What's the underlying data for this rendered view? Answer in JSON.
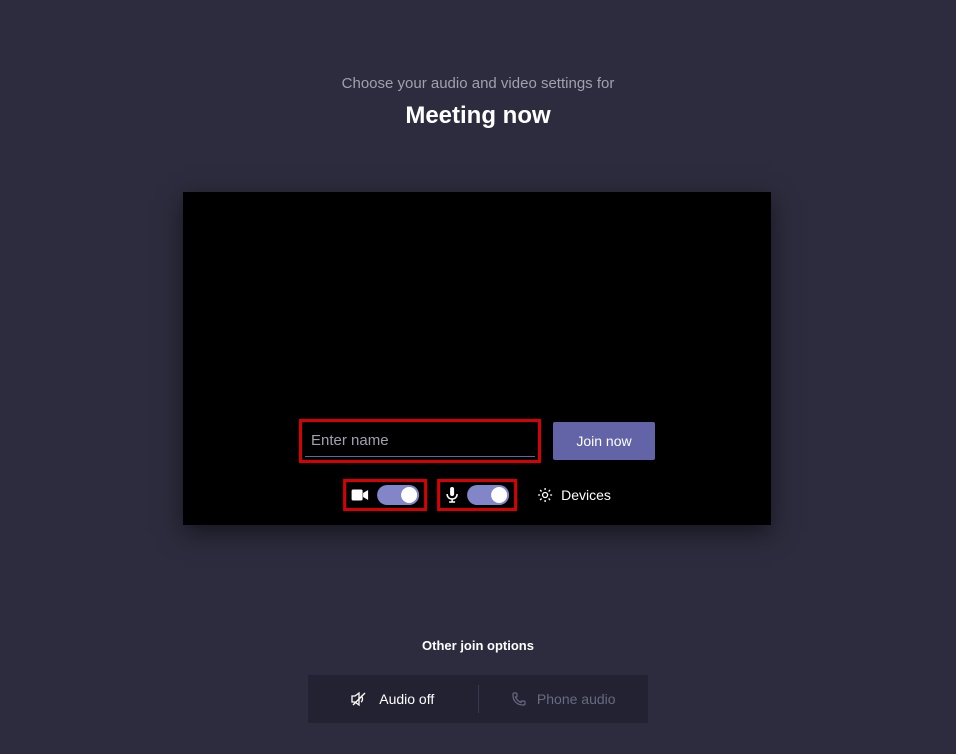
{
  "header": {
    "subtitle": "Choose your audio and video settings for",
    "title": "Meeting now"
  },
  "controls": {
    "name_placeholder": "Enter name",
    "join_label": "Join now",
    "devices_label": "Devices",
    "camera_toggle_on": true,
    "mic_toggle_on": true
  },
  "other_options": {
    "title": "Other join options",
    "audio_off_label": "Audio off",
    "phone_audio_label": "Phone audio"
  },
  "colors": {
    "accent": "#6264a7",
    "highlight_box": "#d80000",
    "background": "#2c2c3e"
  }
}
